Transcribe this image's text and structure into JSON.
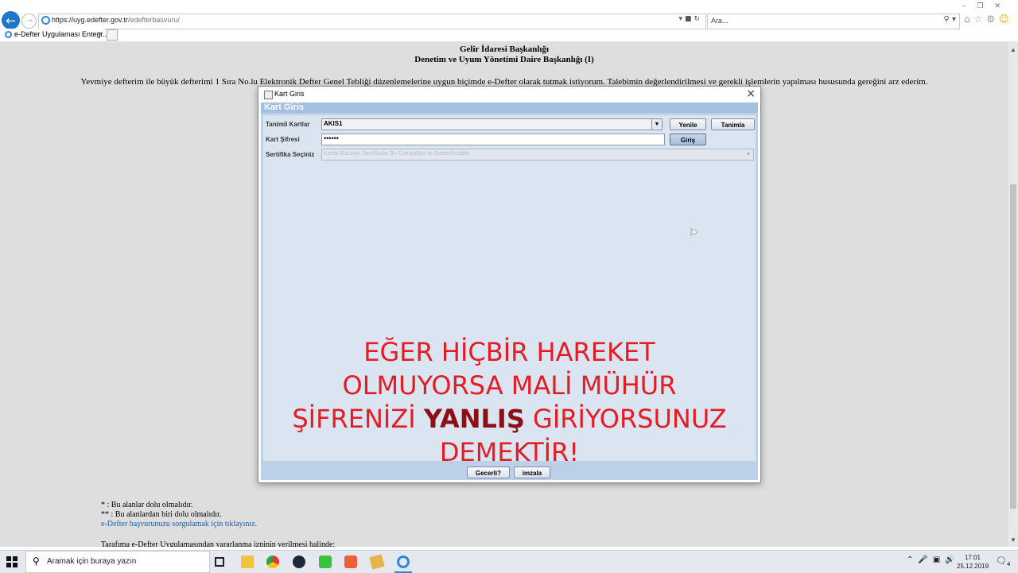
{
  "browser": {
    "url_host": "https://uyg.edefter.gov.tr",
    "url_path": "/edefterbasvuru/",
    "search_placeholder": "Ara...",
    "tab_title": "e-Defter Uygulaması Entegr...",
    "tab_close": "×"
  },
  "page": {
    "org_line1": "Gelir İdaresi Başkanlığı",
    "org_line2": "Denetim ve Uyum Yönetimi Daire Başkanlığı (I)",
    "paragraph": "Yevmiye defterim ile büyük defterimi 1 Sıra No.lu Elektronik Defter Genel Tebliği düzenlemelerine uygun biçimde e-Defter olarak tutmak istiyorum. Talebimin değerlendirilmesi ve gerekli işlemlerin yapılması hususunda gereğini arz ederim.",
    "note1": "* : Bu alanlar dolu olmalıdır.",
    "note2": "** : Bu alanlardan biri dolu olmalıdır.",
    "query_link": "e-Defter başvurunuzu sorgulamak için tıklayınız.",
    "cut_text": "Tarafıma e-Defter Uygulamasından yararlanma izninin verilmesi halinde;"
  },
  "dialog": {
    "window_title": "Kart Giris",
    "header": "Kart Giris",
    "close": "×",
    "label_cards": "Tanimli Kartlar",
    "label_pin": "Kart Şifresi",
    "label_cert": "Sertifika Seçiniz",
    "selected_card": "AKIS1",
    "pin_value": "••••••",
    "cert_placeholder": "Kartta Bulunan Sertifikalar Bu ComboBox ta Gosterilecektir.",
    "btn_refresh": "Yenile",
    "btn_define": "Tanimla",
    "btn_login": "Giriş",
    "btn_valid": "Gecerli?",
    "btn_sign": "imzala"
  },
  "overlay": {
    "line1": "EĞER HİÇBİR HAREKET",
    "line2": "OLMUYORSA MALİ MÜHÜR",
    "line3_pre": "ŞİFRENİZİ ",
    "line3_bold": "YANLIŞ",
    "line3_post": " GİRİYORSUNUZ",
    "line4": "DEMEKTİR!",
    "color_main": "#e41c23",
    "color_bold": "#8b0f14"
  },
  "taskbar": {
    "search_placeholder": "Aramak için buraya yazın",
    "time": "17:01",
    "date": "25.12.2019",
    "notification_count": "4"
  }
}
